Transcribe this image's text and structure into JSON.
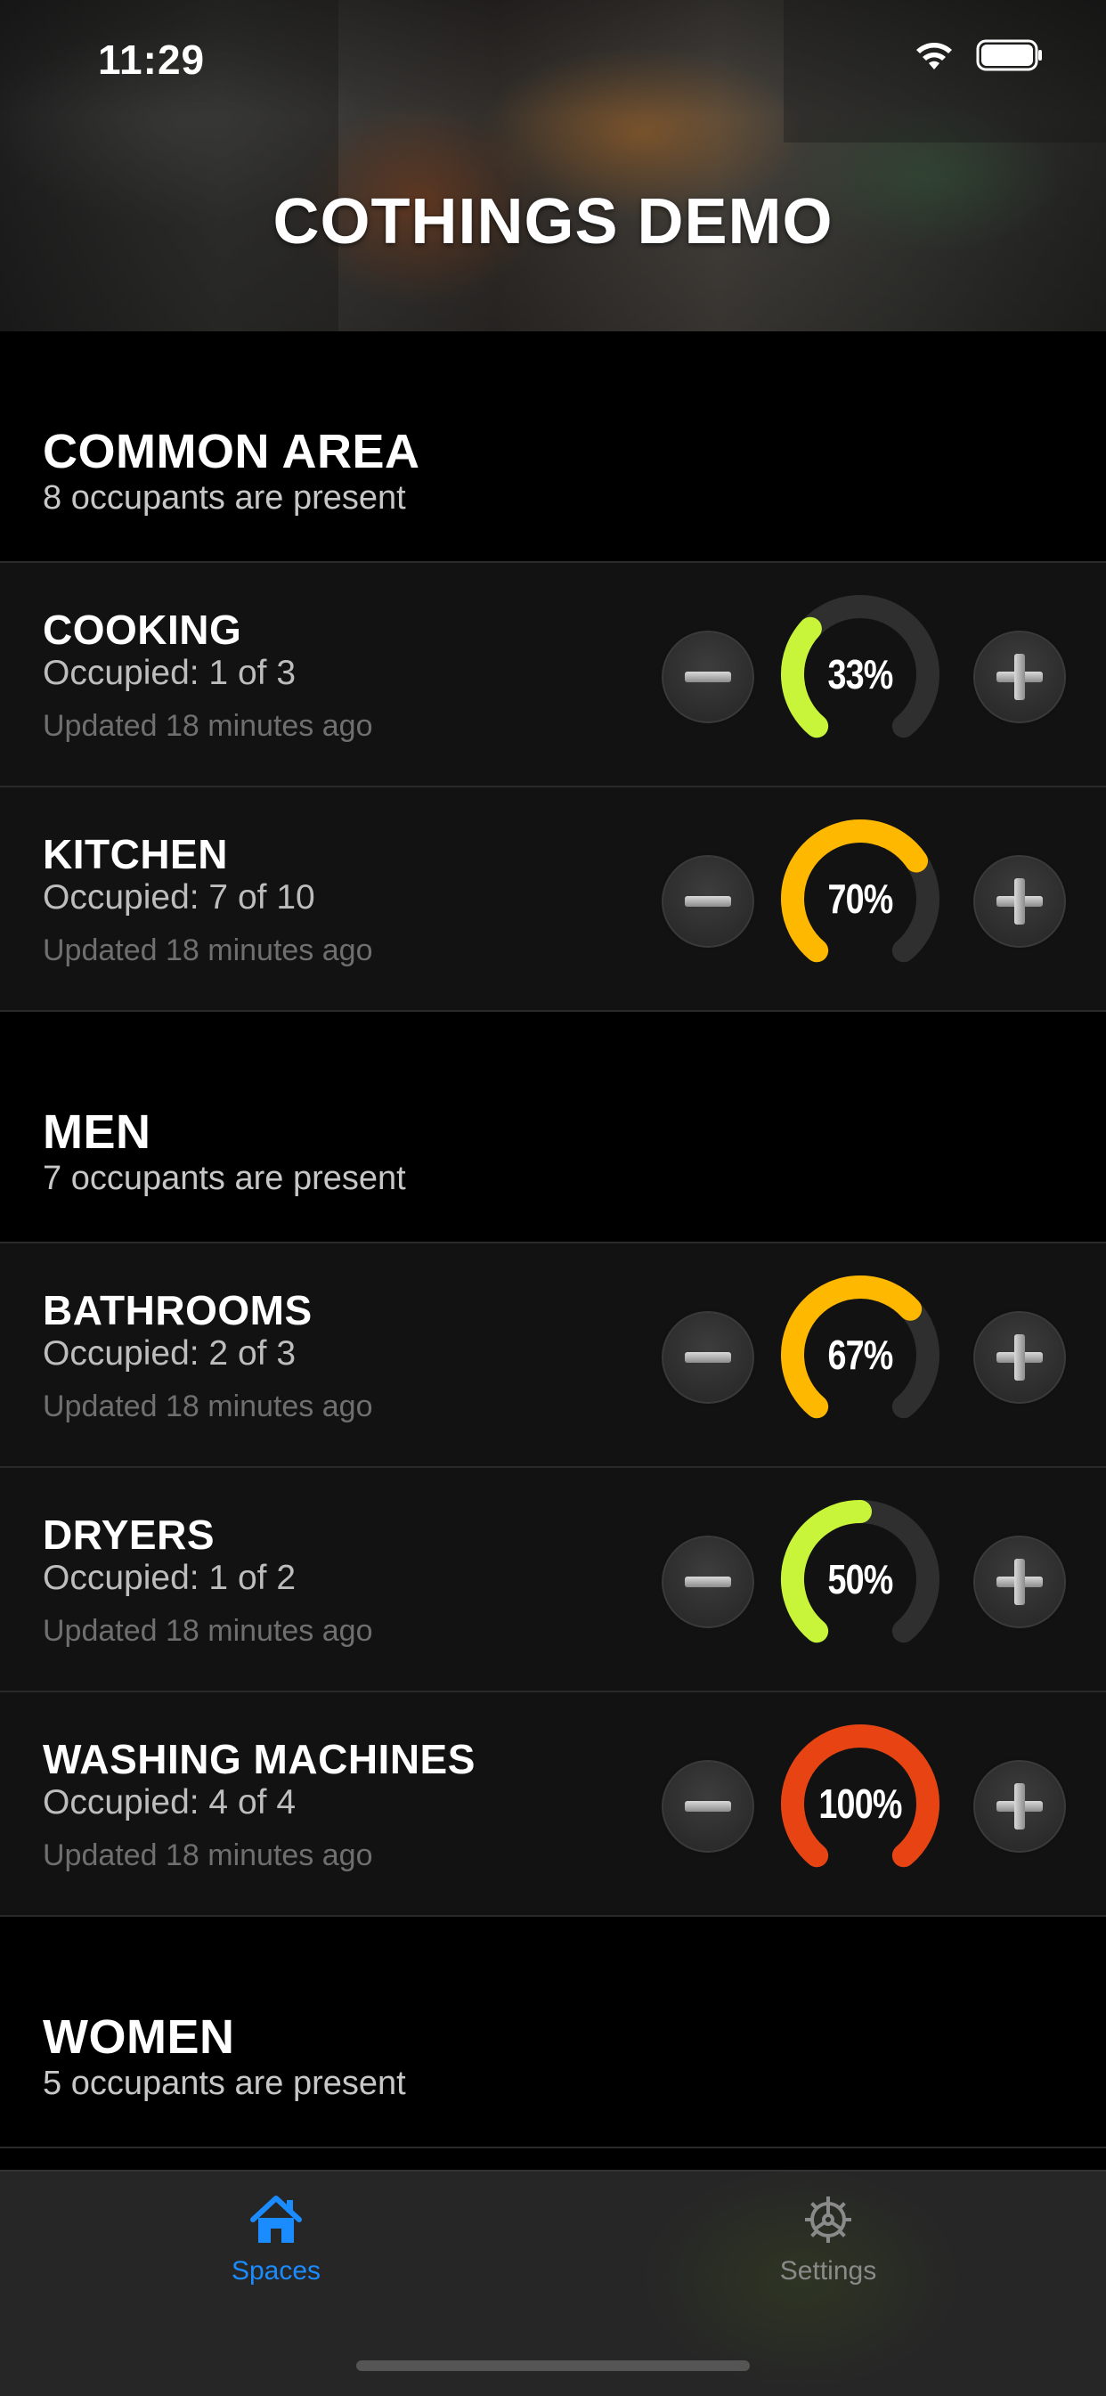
{
  "status": {
    "time": "11:29"
  },
  "header": {
    "title": "COTHINGS DEMO"
  },
  "colors": {
    "accent": "#1a8cff",
    "low": "#c8f53a",
    "mid": "#ffb800",
    "full": "#e84413",
    "track": "#2f2f2f"
  },
  "sections": [
    {
      "title": "COMMON AREA",
      "subtitle": "8 occupants are present",
      "rows": [
        {
          "name": "COOKING",
          "occupied": "Occupied: 1 of 3",
          "updated": "Updated 18 minutes ago",
          "percent_label": "33%",
          "fraction": 0.33,
          "color": "#c8f53a"
        },
        {
          "name": "KITCHEN",
          "occupied": "Occupied: 7 of 10",
          "updated": "Updated 18 minutes ago",
          "percent_label": "70%",
          "fraction": 0.7,
          "color": "#ffb800"
        }
      ]
    },
    {
      "title": "MEN",
      "subtitle": "7 occupants are present",
      "rows": [
        {
          "name": "BATHROOMS",
          "occupied": "Occupied: 2 of 3",
          "updated": "Updated 18 minutes ago",
          "percent_label": "67%",
          "fraction": 0.67,
          "color": "#ffb800"
        },
        {
          "name": "DRYERS",
          "occupied": "Occupied: 1 of 2",
          "updated": "Updated 18 minutes ago",
          "percent_label": "50%",
          "fraction": 0.5,
          "color": "#c8f53a"
        },
        {
          "name": "WASHING MACHINES",
          "occupied": "Occupied: 4 of 4",
          "updated": "Updated 18 minutes ago",
          "percent_label": "100%",
          "fraction": 1.0,
          "color": "#e84413"
        }
      ]
    },
    {
      "title": "WOMEN",
      "subtitle": "5 occupants are present",
      "rows": []
    }
  ],
  "tabs": [
    {
      "label": "Spaces",
      "icon": "home-icon",
      "active": true
    },
    {
      "label": "Settings",
      "icon": "gear-icon",
      "active": false
    }
  ]
}
